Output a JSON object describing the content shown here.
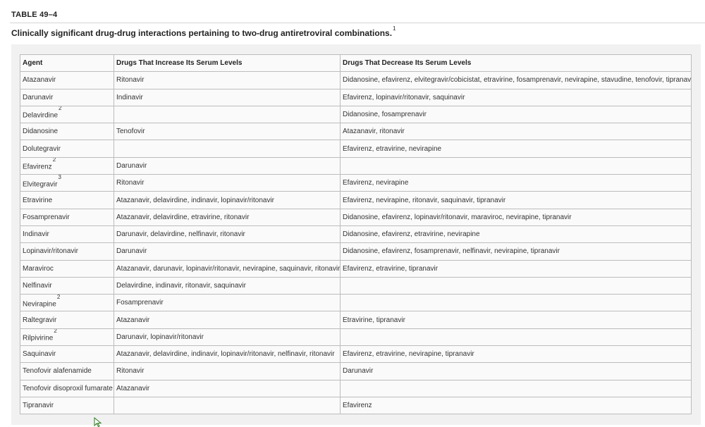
{
  "table_label": "TABLE 49–4",
  "caption": "Clinically significant drug-drug interactions pertaining to two-drug antiretroviral combinations.",
  "caption_footnote": "1",
  "columns": [
    "Agent",
    "Drugs That Increase Its Serum Levels",
    "Drugs That Decrease Its Serum Levels"
  ],
  "rows": [
    {
      "agent": "Atazanavir",
      "fn": "",
      "increase": "Ritonavir",
      "decrease": "Didanosine, efavirenz, elvitegravir/cobicistat, etravirine, fosamprenavir, nevirapine, stavudine, tenofovir, tipranavir"
    },
    {
      "agent": "Darunavir",
      "fn": "",
      "increase": "Indinavir",
      "decrease": "Efavirenz, lopinavir/ritonavir, saquinavir"
    },
    {
      "agent": "Delavirdine",
      "fn": "2",
      "increase": "",
      "decrease": "Didanosine, fosamprenavir"
    },
    {
      "agent": "Didanosine",
      "fn": "",
      "increase": "Tenofovir",
      "decrease": "Atazanavir, ritonavir"
    },
    {
      "agent": "Dolutegravir",
      "fn": "",
      "increase": "",
      "decrease": "Efavirenz, etravirine, nevirapine"
    },
    {
      "agent": "Efavirenz",
      "fn": "2",
      "increase": "Darunavir",
      "decrease": ""
    },
    {
      "agent": "Elvitegravir",
      "fn": "3",
      "increase": "Ritonavir",
      "decrease": "Efavirenz, nevirapine"
    },
    {
      "agent": "Etravirine",
      "fn": "",
      "increase": "Atazanavir, delavirdine, indinavir, lopinavir/ritonavir",
      "decrease": "Efavirenz, nevirapine, ritonavir, saquinavir, tipranavir"
    },
    {
      "agent": "Fosamprenavir",
      "fn": "",
      "increase": "Atazanavir, delavirdine, etravirine, ritonavir",
      "decrease": "Didanosine, efavirenz, lopinavir/ritonavir, maraviroc, nevirapine, tipranavir"
    },
    {
      "agent": "Indinavir",
      "fn": "",
      "increase": "Darunavir, delavirdine, nelfinavir, ritonavir",
      "decrease": "Didanosine, efavirenz, etravirine, nevirapine"
    },
    {
      "agent": "Lopinavir/ritonavir",
      "fn": "",
      "increase": "Darunavir",
      "decrease": "Didanosine, efavirenz, fosamprenavir, nelfinavir, nevirapine, tipranavir"
    },
    {
      "agent": "Maraviroc",
      "fn": "",
      "increase": "Atazanavir, darunavir, lopinavir/ritonavir, nevirapine, saquinavir, ritonavir",
      "decrease": "Efavirenz, etravirine, tipranavir"
    },
    {
      "agent": "Nelfinavir",
      "fn": "",
      "increase": "Delavirdine, indinavir, ritonavir, saquinavir",
      "decrease": ""
    },
    {
      "agent": "Nevirapine",
      "fn": "2",
      "increase": "Fosamprenavir",
      "decrease": ""
    },
    {
      "agent": "Raltegravir",
      "fn": "",
      "increase": "Atazanavir",
      "decrease": "Etravirine, tipranavir"
    },
    {
      "agent": "Rilpivirine",
      "fn": "2",
      "increase": "Darunavir, lopinavir/ritonavir",
      "decrease": ""
    },
    {
      "agent": "Saquinavir",
      "fn": "",
      "increase": "Atazanavir, delavirdine, indinavir, lopinavir/ritonavir, nelfinavir, ritonavir",
      "decrease": "Efavirenz, etravirine, nevirapine, tipranavir"
    },
    {
      "agent": "Tenofovir alafenamide",
      "fn": "",
      "increase": "Ritonavir",
      "decrease": "Darunavir"
    },
    {
      "agent": "Tenofovir disoproxil fumarate",
      "fn": "",
      "increase": "Atazanavir",
      "decrease": ""
    },
    {
      "agent": "Tipranavir",
      "fn": "",
      "increase": "",
      "decrease": "Efavirenz"
    }
  ]
}
